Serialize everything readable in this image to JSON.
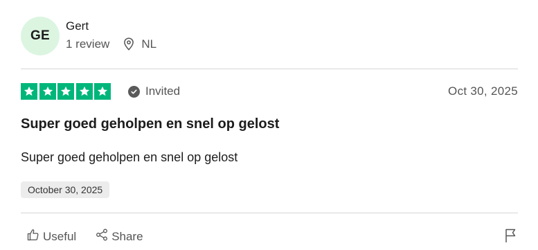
{
  "user": {
    "initials": "GE",
    "name": "Gert",
    "review_count": "1 review",
    "country": "NL"
  },
  "review": {
    "rating": 5,
    "rating_max": 5,
    "status": "Invited",
    "date": "Oct 30, 2025",
    "title": "Super goed geholpen en snel op gelost",
    "text": "Super goed geholpen en snel op gelost",
    "experience_date": "October 30, 2025"
  },
  "actions": {
    "useful_label": "Useful",
    "share_label": "Share"
  },
  "colors": {
    "star_green": "#00b67a",
    "avatar_bg": "#dcf5e1",
    "muted_text": "#555555"
  },
  "icons": [
    "location-pin-icon",
    "star-icon",
    "verified-check-icon",
    "thumbs-up-icon",
    "share-icon",
    "flag-icon"
  ]
}
